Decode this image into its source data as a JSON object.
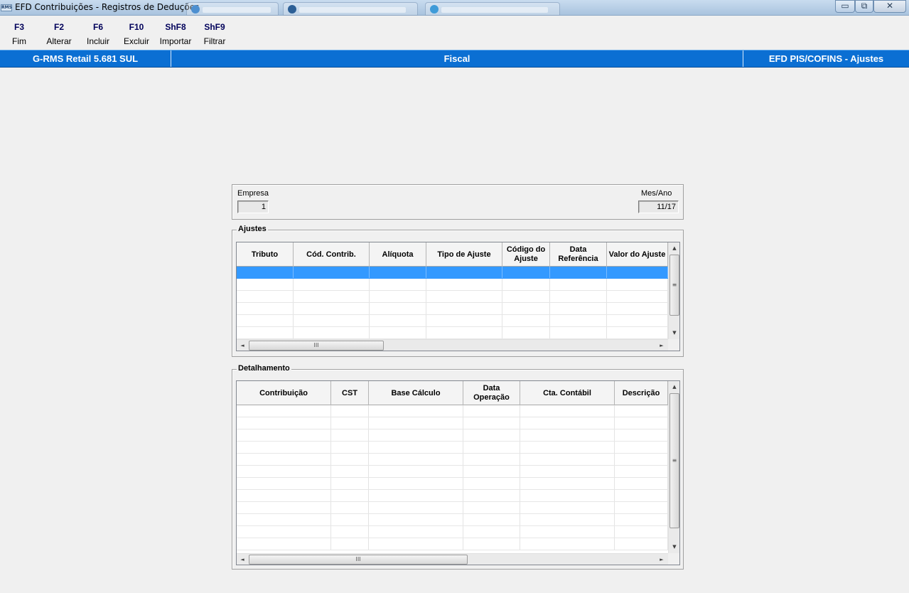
{
  "window": {
    "title": "EFD Contribuições - Registros de Deduções",
    "app_icon_text": "RMS",
    "controls": {
      "minimize": "▭",
      "maximize": "⧉",
      "close": "✕"
    }
  },
  "toolbar": {
    "items": [
      {
        "key": "F3",
        "label": "Fim"
      },
      {
        "key": "F2",
        "label": "Alterar"
      },
      {
        "key": "F6",
        "label": "Incluir"
      },
      {
        "key": "F10",
        "label": "Excluir"
      },
      {
        "key": "ShF8",
        "label": "Importar"
      },
      {
        "key": "ShF9",
        "label": "Filtrar"
      }
    ]
  },
  "header": {
    "left": "G-RMS Retail 5.681 SUL",
    "center": "Fiscal",
    "right": "EFD PIS/COFINS - Ajustes"
  },
  "company": {
    "empresa_label": "Empresa",
    "empresa_value": "1",
    "mes_ano_label": "Mes/Ano",
    "mes_ano_value": "11/17"
  },
  "ajustes": {
    "title": "Ajustes",
    "columns": [
      "Tributo",
      "Cód. Contrib.",
      "Alíquota",
      "Tipo de Ajuste",
      "Código do Ajuste",
      "Data Referência",
      "Valor do Ajuste"
    ],
    "rows": [
      [
        "",
        "",
        "",
        "",
        "",
        "",
        ""
      ]
    ],
    "selected_row": 0
  },
  "detalhamento": {
    "title": "Detalhamento",
    "columns": [
      "Contribuição",
      "CST",
      "Base Cálculo",
      "Data Operação",
      "Cta. Contábil",
      "Descrição"
    ],
    "rows": []
  },
  "scroll": {
    "up": "▲",
    "down": "▼",
    "left": "◄",
    "right": "►",
    "grip": "≡",
    "hgrip": "III"
  },
  "colors": {
    "header_bar": "#0b6fd3",
    "selection": "#3399ff",
    "background": "#f0f0f0"
  }
}
